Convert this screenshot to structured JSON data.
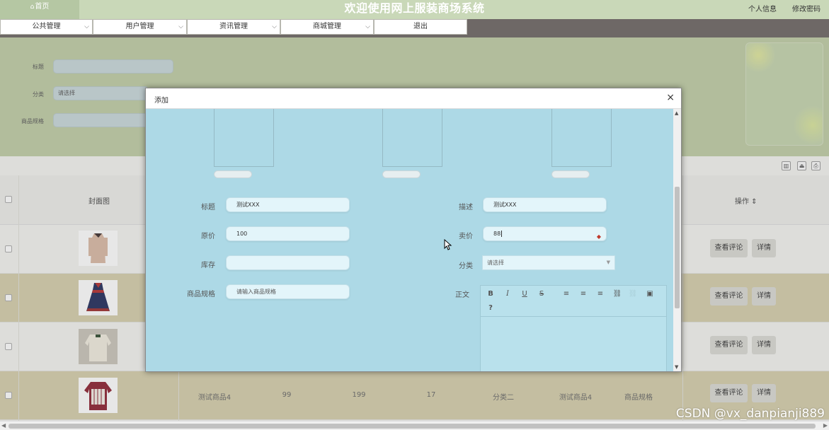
{
  "header": {
    "home_label": "首页",
    "title": "欢迎使用网上服装商场系统",
    "profile_link": "个人信息",
    "password_link": "修改密码"
  },
  "nav": {
    "items": [
      {
        "label": "公共管理"
      },
      {
        "label": "用户管理"
      },
      {
        "label": "资讯管理"
      },
      {
        "label": "商城管理"
      },
      {
        "label": "退出"
      }
    ]
  },
  "search": {
    "title_label": "标题",
    "category_label": "分类",
    "category_value": "请选择",
    "spec_label": "商品规格"
  },
  "table": {
    "headers": {
      "cover": "封面图",
      "actions": "操作 ⇕"
    },
    "rows": [
      {
        "name": "",
        "cells": []
      },
      {
        "name": "",
        "cells": []
      },
      {
        "name": "",
        "cells": []
      },
      {
        "name": "测试商品4",
        "cells": [
          "测试商品4",
          "99",
          "199",
          "17",
          "分类二",
          "测试商品4",
          "商品规格"
        ]
      }
    ],
    "view_comments_label": "查看评论",
    "detail_label": "详情"
  },
  "modal": {
    "title": "添加",
    "close_symbol": "×",
    "fields": {
      "title": {
        "label": "标题",
        "value": "测试XXX"
      },
      "description": {
        "label": "描述",
        "value": "测试XXX"
      },
      "original_price": {
        "label": "原价",
        "value": "100"
      },
      "sale_price": {
        "label": "卖价",
        "value": "88"
      },
      "stock": {
        "label": "库存",
        "value": ""
      },
      "category": {
        "label": "分类",
        "value": "请选择"
      },
      "spec": {
        "label": "商品规格",
        "placeholder": "请输入商品规格"
      },
      "body": {
        "label": "正文"
      }
    }
  },
  "editor": {
    "toolbar": [
      {
        "icon": "bold-icon",
        "glyph": "B"
      },
      {
        "icon": "italic-icon",
        "glyph": "I"
      },
      {
        "icon": "underline-icon",
        "glyph": "U"
      },
      {
        "icon": "strikethrough-icon",
        "glyph": "S"
      },
      {
        "icon": "align-left-icon",
        "glyph": "≡"
      },
      {
        "icon": "align-center-icon",
        "glyph": "≡"
      },
      {
        "icon": "align-right-icon",
        "glyph": "≡"
      },
      {
        "icon": "link-icon",
        "glyph": "⛓"
      },
      {
        "icon": "unlink-icon",
        "glyph": "⛓"
      },
      {
        "icon": "image-icon",
        "glyph": "▣"
      },
      {
        "icon": "help-icon",
        "glyph": "?"
      }
    ]
  },
  "watermark": "CSDN @vx_danpianji889",
  "colors": {
    "topbar": "#c9d8b8",
    "navbar": "#6e6866",
    "modal_body": "#add9e6",
    "row_alt": "#d5ceaa"
  }
}
